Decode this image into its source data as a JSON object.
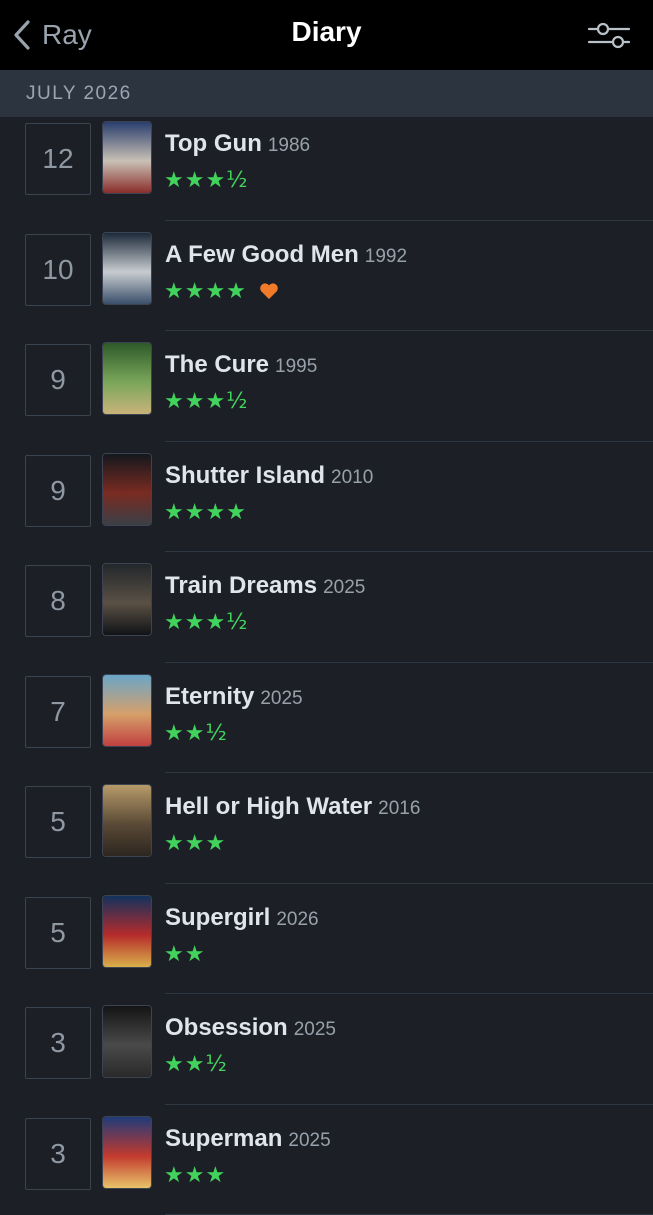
{
  "header": {
    "back_label": "Ray",
    "title": "Diary"
  },
  "section": {
    "label": "JULY 2026"
  },
  "colors": {
    "star_green": "#42d35c",
    "heart_orange": "#f27b2a",
    "background": "#1c2026",
    "header_bg": "#000000"
  },
  "entries": [
    {
      "day": "12",
      "title": "Top Gun",
      "year": "1986",
      "stars": "★★★½",
      "liked": false
    },
    {
      "day": "10",
      "title": "A Few Good Men",
      "year": "1992",
      "stars": "★★★★",
      "liked": true
    },
    {
      "day": "9",
      "title": "The Cure",
      "year": "1995",
      "stars": "★★★½",
      "liked": false
    },
    {
      "day": "9",
      "title": "Shutter Island",
      "year": "2010",
      "stars": "★★★★",
      "liked": false
    },
    {
      "day": "8",
      "title": "Train Dreams",
      "year": "2025",
      "stars": "★★★½",
      "liked": false
    },
    {
      "day": "7",
      "title": "Eternity",
      "year": "2025",
      "stars": "★★½",
      "liked": false
    },
    {
      "day": "5",
      "title": "Hell or High Water",
      "year": "2016",
      "stars": "★★★",
      "liked": false
    },
    {
      "day": "5",
      "title": "Supergirl",
      "year": "2026",
      "stars": "★★",
      "liked": false
    },
    {
      "day": "3",
      "title": "Obsession",
      "year": "2025",
      "stars": "★★½",
      "liked": false
    },
    {
      "day": "3",
      "title": "Superman",
      "year": "2025",
      "stars": "★★★",
      "liked": false
    }
  ]
}
